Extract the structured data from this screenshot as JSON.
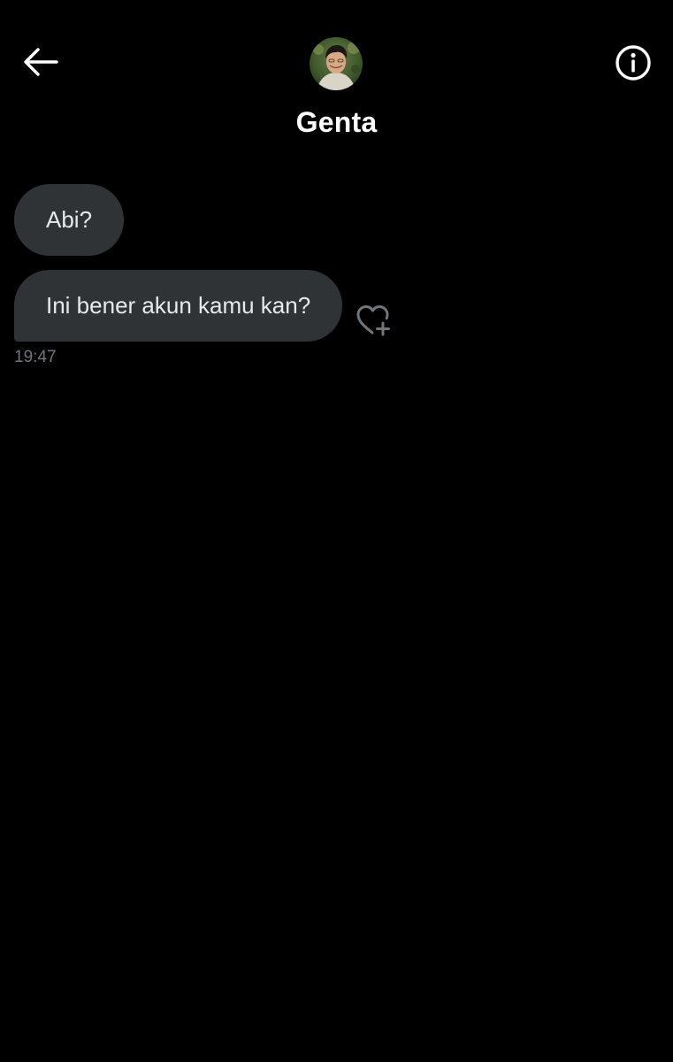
{
  "header": {
    "back_icon": "arrow-left-icon",
    "contact_name": "Genta",
    "avatar": "profile-photo",
    "info_icon": "info-circle-icon"
  },
  "messages": [
    {
      "text": "Abi?",
      "direction": "incoming"
    },
    {
      "text": "Ini bener akun kamu kan?",
      "direction": "incoming",
      "reaction_icon": "heart-plus-icon"
    }
  ],
  "last_timestamp": "19:47",
  "colors": {
    "background": "#000000",
    "bubble": "#2f3336",
    "bubble_text": "#e7e9ea",
    "secondary_text": "#71767b",
    "primary_text": "#ffffff"
  }
}
